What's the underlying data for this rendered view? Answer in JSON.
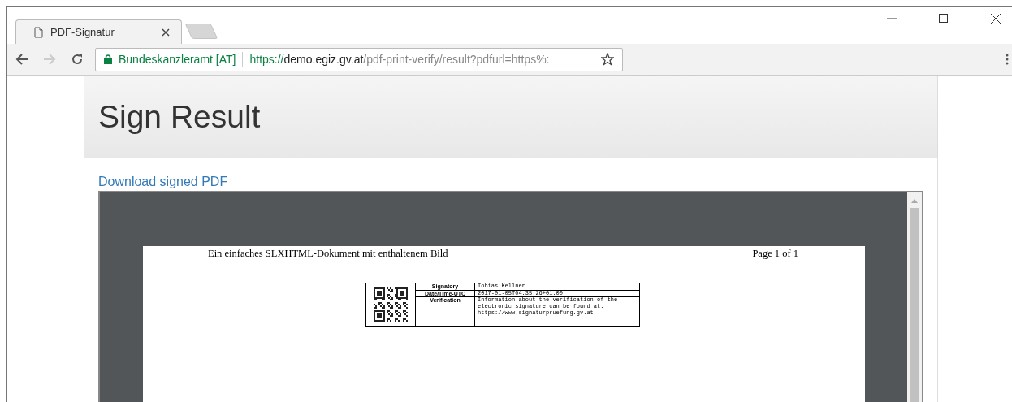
{
  "tabs": [
    {
      "title": "PDF-Signatur",
      "selected": true
    }
  ],
  "address_bar": {
    "site_identity": "Bundeskanzleramt [AT]",
    "url_scheme": "https://",
    "url_host": "demo.egiz.gv.at",
    "url_path": "/pdf-print-verify/result?pdfurl=https%:"
  },
  "page": {
    "heading": "Sign Result",
    "download_link": "Download signed PDF"
  },
  "pdf": {
    "header_left": "Ein einfaches SLXHTML-Dokument mit enthaltenem Bild",
    "header_right": "Page 1 of 1",
    "signature": [
      {
        "label": "Signatory",
        "value": "Tobias Kellner"
      },
      {
        "label": "Date/Time-UTC",
        "value": "2017-01-05T04:35:26+01:00"
      },
      {
        "label": "Verification",
        "value": "Information about the verification of the electronic signature can be found at: https://www.signaturpruefung.gv.at"
      }
    ]
  }
}
